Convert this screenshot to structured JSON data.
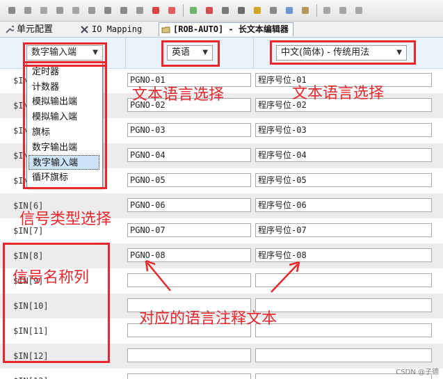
{
  "colors": {
    "annotation": "#e8272c",
    "header_bg": "#eaf2fb",
    "alt_row": "#ececec"
  },
  "toolbar": {
    "icons": [
      "wrench-icon",
      "play-icon",
      "pause-icon",
      "step-icon",
      "stop-icon",
      "settings-icon",
      "doc-icon",
      "network-icon",
      "save-icon",
      "record-icon",
      "robot-arm-icon",
      "flag-icon",
      "target-icon",
      "cut-icon",
      "search-icon",
      "variable-icon",
      "edit-icon",
      "book-icon",
      "module-icon",
      "gear-icon",
      "tool-icon",
      "grid-icon"
    ]
  },
  "tabs": [
    {
      "label": "单元配置",
      "icon": "wrench-icon"
    },
    {
      "label": "IO Mapping",
      "icon": "scissors-icon"
    },
    {
      "label": "[ROB-AUTO] - 长文本编辑器",
      "icon": "folder-icon"
    }
  ],
  "header": {
    "signal_type": "数字输入端",
    "language": "英语",
    "language2": "中文(简体) - 传统用法"
  },
  "dropdown": {
    "options": [
      "定时器",
      "计数器",
      "模拟输出端",
      "模拟输入端",
      "旗标",
      "数字输出端",
      "数字输入端",
      "循环旗标"
    ],
    "selected_index": 6
  },
  "rows": [
    {
      "name": "$IN[1]",
      "col1": "PGNO-01",
      "col2": "程序号位-01"
    },
    {
      "name": "$IN[2]",
      "col1": "PGNO-02",
      "col2": "程序号位-02"
    },
    {
      "name": "$IN[3]",
      "col1": "PGNO-03",
      "col2": "程序号位-03"
    },
    {
      "name": "$IN[4]",
      "col1": "PGNO-04",
      "col2": "程序号位-04"
    },
    {
      "name": "$IN[5]",
      "col1": "PGNO-05",
      "col2": "程序号位-05"
    },
    {
      "name": "$IN[6]",
      "col1": "PGNO-06",
      "col2": "程序号位-06"
    },
    {
      "name": "$IN[7]",
      "col1": "PGNO-07",
      "col2": "程序号位-07"
    },
    {
      "name": "$IN[8]",
      "col1": "PGNO-08",
      "col2": "程序号位-08"
    },
    {
      "name": "$IN[9]",
      "col1": "",
      "col2": ""
    },
    {
      "name": "$IN[10]",
      "col1": "",
      "col2": ""
    },
    {
      "name": "$IN[11]",
      "col1": "",
      "col2": ""
    },
    {
      "name": "$IN[12]",
      "col1": "",
      "col2": ""
    },
    {
      "name": "$IN[13]",
      "col1": "",
      "col2": ""
    }
  ],
  "annotations": {
    "lang_select_1": "文本语言选择",
    "lang_select_2": "文本语言选择",
    "signal_type_select": "信号类型选择",
    "signal_name_col": "信号名称列",
    "comment_text": "对应的语言注释文本"
  },
  "watermark": "CSDN @子德"
}
